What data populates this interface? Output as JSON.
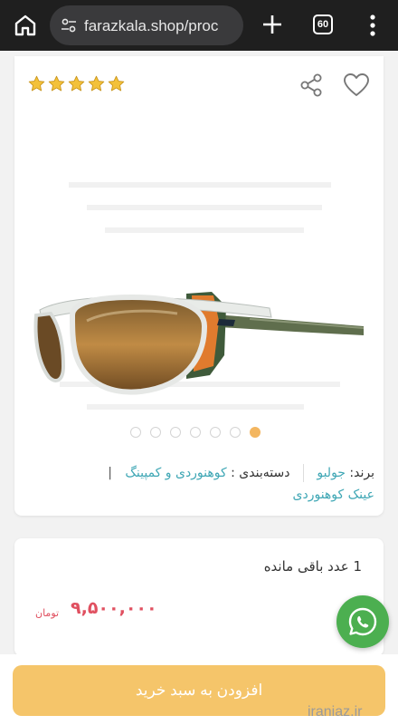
{
  "browser": {
    "url": "farazkala.shop/proc",
    "tab_count": "60"
  },
  "product": {
    "rating_stars": 5,
    "image_name": "julbo-sunglasses",
    "carousel": {
      "total": 7,
      "active_index": 6
    },
    "brand_label": "برند:",
    "brand_value": "جولبو",
    "category_label": "دسته‌بندی :",
    "category_value_1": "کوهنوردی و کمپینگ",
    "category_separator": "|",
    "category_value_2": "عینک کوهنوردی"
  },
  "price": {
    "stock_text": "1 عدد باقی مانده",
    "amount": "۹,۵۰۰,۰۰۰",
    "currency": "تومان"
  },
  "actions": {
    "add_to_cart_label": "افزودن به سبد خرید"
  },
  "watermark": "iraniaz.ir",
  "colors": {
    "accent": "#f5c56a",
    "star": "#f3c13a",
    "link": "#3fa7b5",
    "price": "#e05060",
    "whatsapp": "#4caf50"
  },
  "icons": [
    "home-icon",
    "site-settings-icon",
    "plus-icon",
    "tab-switcher-icon",
    "more-vert-icon",
    "star-icon",
    "share-icon",
    "heart-icon",
    "whatsapp-icon"
  ]
}
